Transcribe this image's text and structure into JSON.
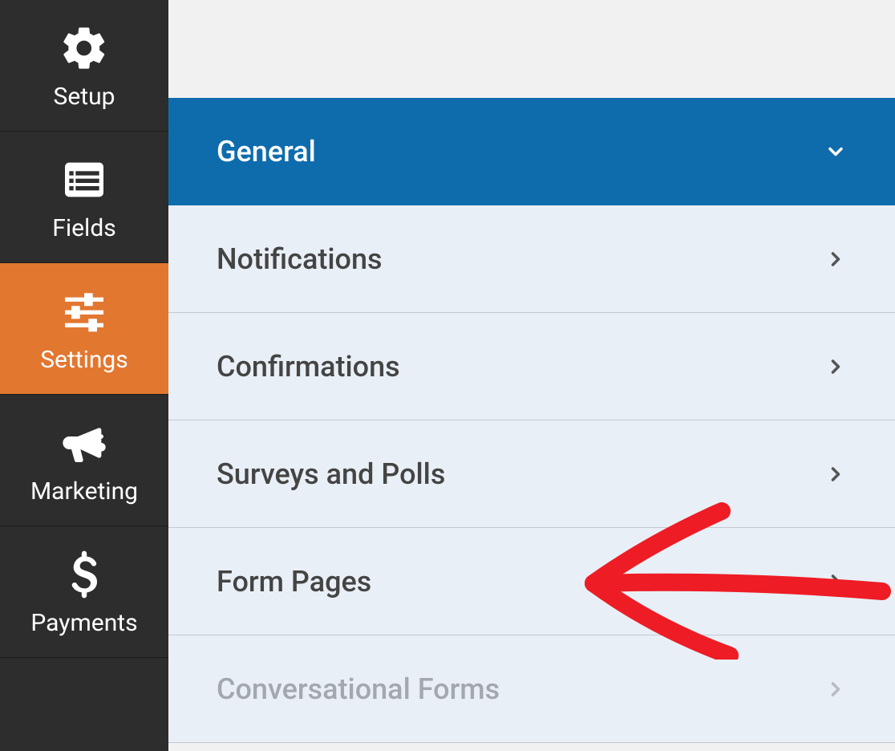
{
  "sidebar": {
    "items": [
      {
        "label": "Setup",
        "icon": "gear",
        "active": false
      },
      {
        "label": "Fields",
        "icon": "list",
        "active": false
      },
      {
        "label": "Settings",
        "icon": "sliders",
        "active": true
      },
      {
        "label": "Marketing",
        "icon": "bullhorn",
        "active": false
      },
      {
        "label": "Payments",
        "icon": "dollar",
        "active": false
      }
    ]
  },
  "settings_panel": {
    "items": [
      {
        "label": "General",
        "type": "header",
        "chevron": "down"
      },
      {
        "label": "Notifications",
        "type": "normal",
        "chevron": "right"
      },
      {
        "label": "Confirmations",
        "type": "normal",
        "chevron": "right"
      },
      {
        "label": "Surveys and Polls",
        "type": "normal",
        "chevron": "right"
      },
      {
        "label": "Form Pages",
        "type": "normal",
        "chevron": "right"
      },
      {
        "label": "Conversational Forms",
        "type": "disabled",
        "chevron": "right"
      }
    ]
  },
  "annotation": {
    "target": "Form Pages"
  }
}
